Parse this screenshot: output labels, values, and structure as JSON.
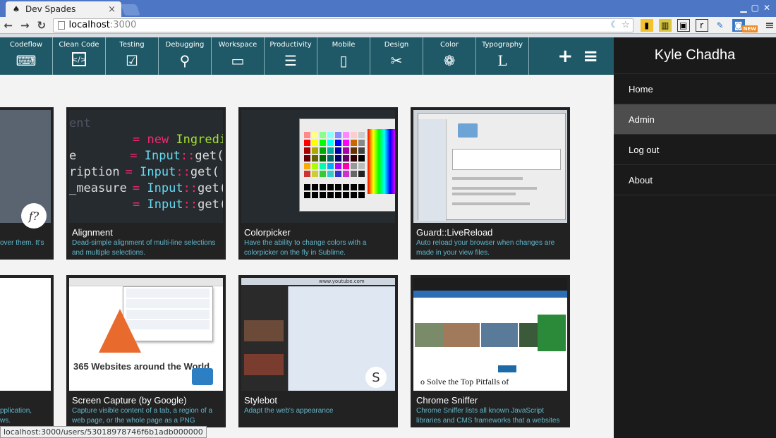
{
  "browser": {
    "tab_title": "Dev Spades",
    "tab_close": "×",
    "url_host": "localhost",
    "url_port": ":3000",
    "status_url": "localhost:3000/users/53018978746f6b1adb000000",
    "new_badge": "NEW"
  },
  "categories": [
    {
      "label": "Codeflow",
      "icon": "keyboard-icon"
    },
    {
      "label": "Clean Code",
      "icon": "code-file-icon"
    },
    {
      "label": "Testing",
      "icon": "checkbox-icon"
    },
    {
      "label": "Debugging",
      "icon": "magnifier-icon"
    },
    {
      "label": "Workspace",
      "icon": "monitor-icon"
    },
    {
      "label": "Productivity",
      "icon": "checklist-icon"
    },
    {
      "label": "Mobile",
      "icon": "phone-icon"
    },
    {
      "label": "Design",
      "icon": "tools-icon"
    },
    {
      "label": "Color",
      "icon": "palette-icon"
    },
    {
      "label": "Typography",
      "icon": "typography-icon"
    }
  ],
  "cards": [
    {
      "title": "Alignment",
      "desc": "Dead-simple alignment of multi-line selections and multiple selections."
    },
    {
      "title": "Colorpicker",
      "desc": "Have the ability to change colors with a colorpicker on the fly in Sublime."
    },
    {
      "title": "Guard::LiveReload",
      "desc": "Auto reload your browser when changes are made in your view files."
    },
    {
      "title": "Screen Capture (by Google)",
      "desc": "Capture visible content of a tab, a region of a web page, or the whole page as a PNG"
    },
    {
      "title": "Stylebot",
      "desc": "Adapt the web's appearance"
    },
    {
      "title": "Chrome Sniffer",
      "desc": "Chrome Sniffer lists all known JavaScript libraries and CMS frameworks that a websites"
    }
  ],
  "partial_cards": {
    "top_desc": "over them. It's",
    "bottom_desc_1": "pplication,",
    "bottom_desc_2": "ws."
  },
  "code_thumb": {
    "l1a": "ent",
    "l2a": "= ",
    "l2b": "new ",
    "l2c": "Ingredi",
    "l3a": "e",
    "l3b": "= ",
    "l3c": "Input",
    "l3d": "::",
    "l3e": "get(",
    "l4a": "ription",
    "l5a": "_measure"
  },
  "thumb_texts": {
    "screen_capture_headline": "365 Websites around the World",
    "chrome_sniffer_headline": "o Solve the Top Pitfalls of",
    "stylebot_site": "www.youtube.com"
  },
  "sidebar": {
    "title": "Kyle Chadha",
    "items": [
      "Home",
      "Admin",
      "Log out",
      "About"
    ]
  }
}
